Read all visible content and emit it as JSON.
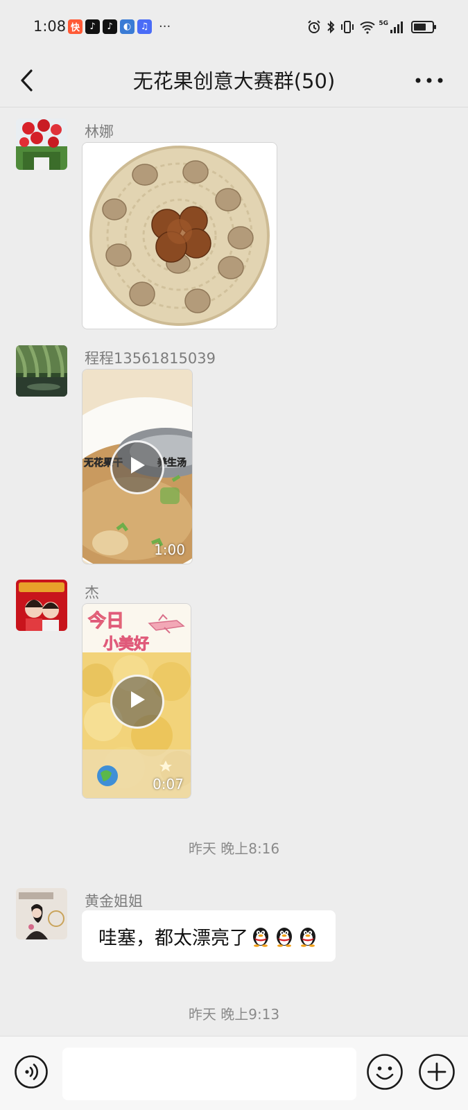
{
  "status_bar": {
    "time": "1:08",
    "app_icons": [
      {
        "name": "kuaishou-icon",
        "glyph": "快",
        "color": "#ff5a36"
      },
      {
        "name": "douyin-lite-icon",
        "glyph": "♪",
        "color": "#111111"
      },
      {
        "name": "douyin-icon",
        "glyph": "♪",
        "color": "#111111"
      },
      {
        "name": "browser-icon",
        "glyph": "◐",
        "color": "#3a7bd5"
      },
      {
        "name": "music-icon",
        "glyph": "♫",
        "color": "#4a6cf7"
      }
    ],
    "more": "···",
    "network_label": "5G"
  },
  "header": {
    "title": "无花果创意大赛群(50)"
  },
  "messages": [
    {
      "sender": "林娜",
      "type": "image"
    },
    {
      "sender": "程程13561815039",
      "type": "video",
      "caption": "无花果干",
      "caption_tail": "养生汤",
      "duration": "1:00"
    },
    {
      "sender": "杰",
      "type": "video",
      "overlay_title_1": "今日",
      "overlay_title_2": "小美好",
      "duration": "0:07"
    }
  ],
  "timestamps": [
    "昨天 晚上8:16",
    "昨天 晚上9:13"
  ],
  "text_message": {
    "sender": "黄金姐姐",
    "text": "哇塞，都太漂亮了"
  },
  "colors": {
    "background": "#ededed",
    "bubble": "#ffffff",
    "meta_text": "#8a8a8a"
  }
}
